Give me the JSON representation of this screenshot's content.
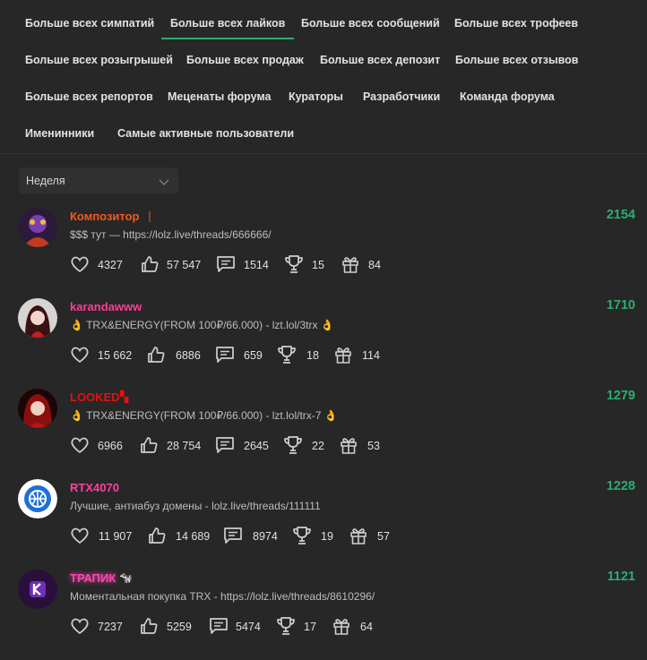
{
  "tabs": [
    {
      "label": "Больше всех симпатий",
      "active": false
    },
    {
      "label": "Больше всех лайков",
      "active": true
    },
    {
      "label": "Больше всех сообщений",
      "active": false
    },
    {
      "label": "Больше всех трофеев",
      "active": false
    },
    {
      "label": "Больше всех розыгрышей",
      "active": false
    },
    {
      "label": "Больше всех продаж",
      "active": false
    },
    {
      "label": "Больше всех депозит",
      "active": false
    },
    {
      "label": "Больше всех отзывов",
      "active": false
    },
    {
      "label": "Больше всех репортов",
      "active": false
    },
    {
      "label": "Меценаты форума",
      "active": false
    },
    {
      "label": "Кураторы",
      "active": false
    },
    {
      "label": "Разработчики",
      "active": false
    },
    {
      "label": "Команда форума",
      "active": false
    },
    {
      "label": "Именинники",
      "active": false
    },
    {
      "label": "Самые активные пользователи",
      "active": false
    }
  ],
  "period_select": {
    "value": "Неделя"
  },
  "colors": {
    "accent": "#2bad72",
    "background": "#272727",
    "select_bg": "#303030"
  },
  "users": [
    {
      "name": "Композитор",
      "name_color": "#f05a1a",
      "badge": "🍷",
      "status": "$$$ тут — https://lolz.live/threads/666666/",
      "hand_before": false,
      "hand_after": false,
      "stats": {
        "sympathies": "4327",
        "likes": "57 547",
        "messages": "1514",
        "trophies": "15",
        "gifts": "84"
      },
      "score": "2154"
    },
    {
      "name": "karandawww",
      "name_color": "#ff3b9a",
      "badge": "",
      "status": "TRX&ENERGY(FROM 100₽/66.000) - lzt.lol/3trx",
      "hand_before": true,
      "hand_after": true,
      "stats": {
        "sympathies": "15 662",
        "likes": "6886",
        "messages": "659",
        "trophies": "18",
        "gifts": "114"
      },
      "score": "1710"
    },
    {
      "name": "LOOKED",
      "name_color": "#e01212",
      "badge": "🔴",
      "status": "TRX&ENERGY(FROM 100₽/66.000) - lzt.lol/trx-7",
      "hand_before": true,
      "hand_after": true,
      "stats": {
        "sympathies": "6966",
        "likes": "28 754",
        "messages": "2645",
        "trophies": "22",
        "gifts": "53"
      },
      "score": "1279"
    },
    {
      "name": "RTX4070",
      "name_color": "#ff3fa3",
      "badge": "",
      "status": "Лучшие, антиабуз домены - lolz.live/threads/111111",
      "hand_before": false,
      "hand_after": false,
      "stats": {
        "sympathies": "11 907",
        "likes": "14 689",
        "messages": "8974",
        "trophies": "19",
        "gifts": "57"
      },
      "score": "1228"
    },
    {
      "name": "ТРАПИК",
      "name_color": "#ff45b0",
      "badge": "🐄",
      "status": "Моментальная покупка TRX - https://lolz.live/threads/8610296/",
      "hand_before": false,
      "hand_after": false,
      "stats": {
        "sympathies": "7237",
        "likes": "5259",
        "messages": "5474",
        "trophies": "17",
        "gifts": "64"
      },
      "score": "1121"
    }
  ]
}
